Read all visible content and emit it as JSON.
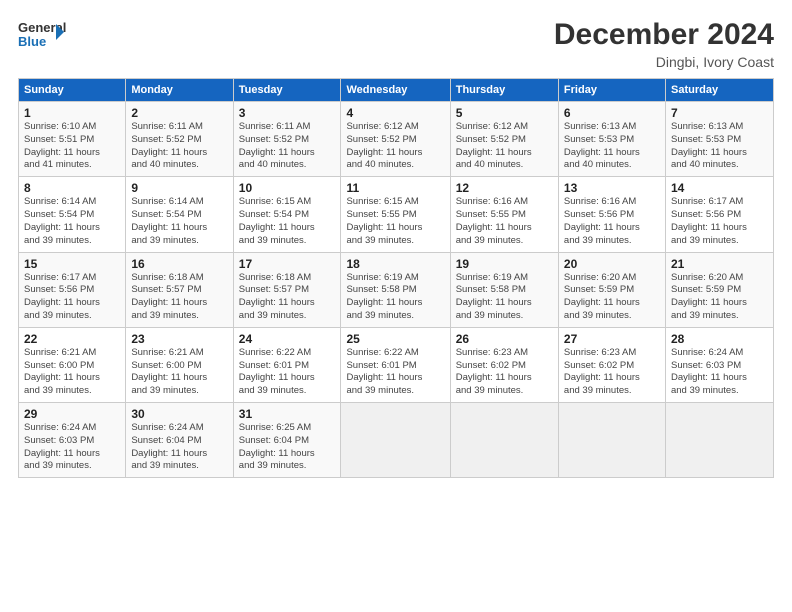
{
  "logo": {
    "line1": "General",
    "line2": "Blue"
  },
  "header": {
    "title": "December 2024",
    "subtitle": "Dingbi, Ivory Coast"
  },
  "days_of_week": [
    "Sunday",
    "Monday",
    "Tuesday",
    "Wednesday",
    "Thursday",
    "Friday",
    "Saturday"
  ],
  "weeks": [
    [
      {
        "day": "1",
        "info": "Sunrise: 6:10 AM\nSunset: 5:51 PM\nDaylight: 11 hours\nand 41 minutes."
      },
      {
        "day": "2",
        "info": "Sunrise: 6:11 AM\nSunset: 5:52 PM\nDaylight: 11 hours\nand 40 minutes."
      },
      {
        "day": "3",
        "info": "Sunrise: 6:11 AM\nSunset: 5:52 PM\nDaylight: 11 hours\nand 40 minutes."
      },
      {
        "day": "4",
        "info": "Sunrise: 6:12 AM\nSunset: 5:52 PM\nDaylight: 11 hours\nand 40 minutes."
      },
      {
        "day": "5",
        "info": "Sunrise: 6:12 AM\nSunset: 5:52 PM\nDaylight: 11 hours\nand 40 minutes."
      },
      {
        "day": "6",
        "info": "Sunrise: 6:13 AM\nSunset: 5:53 PM\nDaylight: 11 hours\nand 40 minutes."
      },
      {
        "day": "7",
        "info": "Sunrise: 6:13 AM\nSunset: 5:53 PM\nDaylight: 11 hours\nand 40 minutes."
      }
    ],
    [
      {
        "day": "8",
        "info": "Sunrise: 6:14 AM\nSunset: 5:54 PM\nDaylight: 11 hours\nand 39 minutes."
      },
      {
        "day": "9",
        "info": "Sunrise: 6:14 AM\nSunset: 5:54 PM\nDaylight: 11 hours\nand 39 minutes."
      },
      {
        "day": "10",
        "info": "Sunrise: 6:15 AM\nSunset: 5:54 PM\nDaylight: 11 hours\nand 39 minutes."
      },
      {
        "day": "11",
        "info": "Sunrise: 6:15 AM\nSunset: 5:55 PM\nDaylight: 11 hours\nand 39 minutes."
      },
      {
        "day": "12",
        "info": "Sunrise: 6:16 AM\nSunset: 5:55 PM\nDaylight: 11 hours\nand 39 minutes."
      },
      {
        "day": "13",
        "info": "Sunrise: 6:16 AM\nSunset: 5:56 PM\nDaylight: 11 hours\nand 39 minutes."
      },
      {
        "day": "14",
        "info": "Sunrise: 6:17 AM\nSunset: 5:56 PM\nDaylight: 11 hours\nand 39 minutes."
      }
    ],
    [
      {
        "day": "15",
        "info": "Sunrise: 6:17 AM\nSunset: 5:56 PM\nDaylight: 11 hours\nand 39 minutes."
      },
      {
        "day": "16",
        "info": "Sunrise: 6:18 AM\nSunset: 5:57 PM\nDaylight: 11 hours\nand 39 minutes."
      },
      {
        "day": "17",
        "info": "Sunrise: 6:18 AM\nSunset: 5:57 PM\nDaylight: 11 hours\nand 39 minutes."
      },
      {
        "day": "18",
        "info": "Sunrise: 6:19 AM\nSunset: 5:58 PM\nDaylight: 11 hours\nand 39 minutes."
      },
      {
        "day": "19",
        "info": "Sunrise: 6:19 AM\nSunset: 5:58 PM\nDaylight: 11 hours\nand 39 minutes."
      },
      {
        "day": "20",
        "info": "Sunrise: 6:20 AM\nSunset: 5:59 PM\nDaylight: 11 hours\nand 39 minutes."
      },
      {
        "day": "21",
        "info": "Sunrise: 6:20 AM\nSunset: 5:59 PM\nDaylight: 11 hours\nand 39 minutes."
      }
    ],
    [
      {
        "day": "22",
        "info": "Sunrise: 6:21 AM\nSunset: 6:00 PM\nDaylight: 11 hours\nand 39 minutes."
      },
      {
        "day": "23",
        "info": "Sunrise: 6:21 AM\nSunset: 6:00 PM\nDaylight: 11 hours\nand 39 minutes."
      },
      {
        "day": "24",
        "info": "Sunrise: 6:22 AM\nSunset: 6:01 PM\nDaylight: 11 hours\nand 39 minutes."
      },
      {
        "day": "25",
        "info": "Sunrise: 6:22 AM\nSunset: 6:01 PM\nDaylight: 11 hours\nand 39 minutes."
      },
      {
        "day": "26",
        "info": "Sunrise: 6:23 AM\nSunset: 6:02 PM\nDaylight: 11 hours\nand 39 minutes."
      },
      {
        "day": "27",
        "info": "Sunrise: 6:23 AM\nSunset: 6:02 PM\nDaylight: 11 hours\nand 39 minutes."
      },
      {
        "day": "28",
        "info": "Sunrise: 6:24 AM\nSunset: 6:03 PM\nDaylight: 11 hours\nand 39 minutes."
      }
    ],
    [
      {
        "day": "29",
        "info": "Sunrise: 6:24 AM\nSunset: 6:03 PM\nDaylight: 11 hours\nand 39 minutes."
      },
      {
        "day": "30",
        "info": "Sunrise: 6:24 AM\nSunset: 6:04 PM\nDaylight: 11 hours\nand 39 minutes."
      },
      {
        "day": "31",
        "info": "Sunrise: 6:25 AM\nSunset: 6:04 PM\nDaylight: 11 hours\nand 39 minutes."
      },
      {
        "day": "",
        "info": ""
      },
      {
        "day": "",
        "info": ""
      },
      {
        "day": "",
        "info": ""
      },
      {
        "day": "",
        "info": ""
      }
    ]
  ]
}
